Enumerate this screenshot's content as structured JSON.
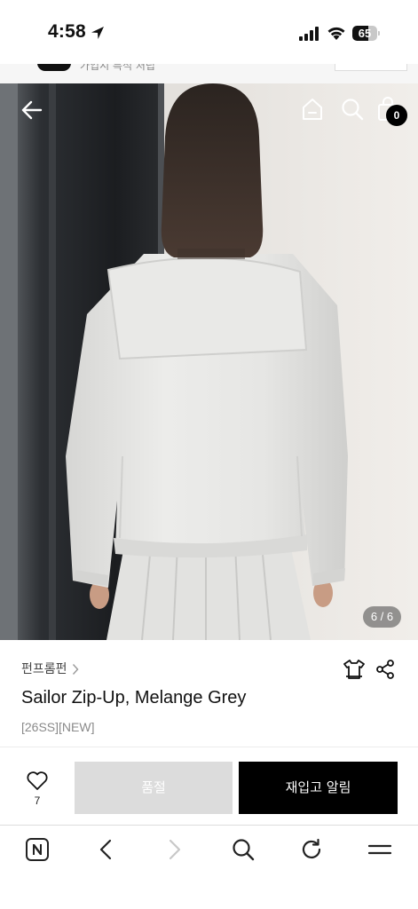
{
  "status_bar": {
    "time": "4:58",
    "battery": "65",
    "battery_level": 0.65,
    "icons": [
      "location-arrow-icon",
      "cellular-signal-icon",
      "wifi-icon",
      "battery-icon"
    ]
  },
  "peek_header": {
    "text": "가입시 특석 처립"
  },
  "hero": {
    "image": "model-back-sweatshirt-photo",
    "counter": "6 / 6",
    "cart_count": "0",
    "icons": [
      "back-arrow-icon",
      "home-icon",
      "search-icon",
      "shopping-bag-icon"
    ]
  },
  "product": {
    "brand": "펀프롬펀",
    "title": "Sailor Zip-Up, Melange Grey",
    "tag": "[26SS][NEW]",
    "icons": [
      "chevron-right-icon",
      "size-fit-icon",
      "share-icon"
    ]
  },
  "actions": {
    "like_count": "7",
    "soldout_label": "품절",
    "restock_label": "재입고 알림",
    "colors": {
      "soldout_bg": "#dcdcdc",
      "restock_bg": "#000000"
    }
  },
  "browser_toolbar": {
    "icons": [
      "naver-n-icon",
      "browser-back-icon",
      "browser-forward-icon",
      "browser-search-icon",
      "reload-icon",
      "menu-icon"
    ]
  }
}
